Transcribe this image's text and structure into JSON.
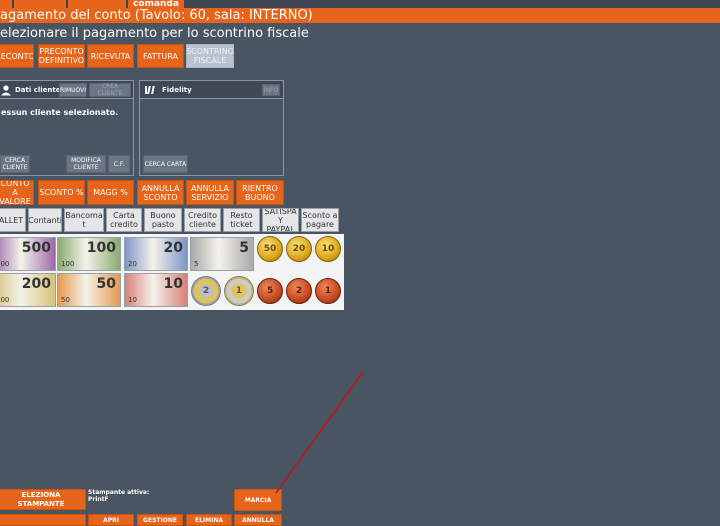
{
  "top_tab": "comanda",
  "title": "agamento del conto (Tavolo: 60, sala: INTERNO)",
  "subtitle": "elezionare il pagamento per lo scontrino fiscale",
  "doc_buttons": [
    {
      "label": "RECONTO"
    },
    {
      "label": "PRECONTO\nDEFINITIVO"
    },
    {
      "label": "RICEVUTA"
    },
    {
      "label": "FATTURA"
    },
    {
      "label": "SCONTRINO\nFISCALE",
      "selected": true
    }
  ],
  "customer_panel": {
    "title": "Dati cliente",
    "remove_label": "RIMUOVI",
    "crea_label": "CREA\nCLIENTE",
    "no_customer": "essun cliente selezionato.",
    "search_label": "CERCA\nCLIENTE",
    "edit_label": "MODIFICA\nCLIENTE",
    "cf_label": "C.F."
  },
  "fidelity_panel": {
    "title": "Fidelity",
    "search_card_label": "CERCA CARTA",
    "corner_label": "INFO"
  },
  "discount_buttons": [
    {
      "label": "CONTO A\nVALORE"
    },
    {
      "label": "SCONTO %"
    },
    {
      "label": "MAGG %"
    },
    {
      "label": "ANNULLA\nSCONTO"
    },
    {
      "label": "ANNULLA\nSERVIZIO"
    },
    {
      "label": "RIENTRO\nBUONO"
    }
  ],
  "payment_methods": [
    {
      "label": "ALLET"
    },
    {
      "label": "Contanti"
    },
    {
      "label": "Bancoma\nt"
    },
    {
      "label": "Carta\ncredito"
    },
    {
      "label": "Buono\npasto"
    },
    {
      "label": "Credito\ncliente"
    },
    {
      "label": "Resto\nticket"
    },
    {
      "label": "SATISPA\nY\nPAYPAL"
    },
    {
      "label": "Sconto a\npagare"
    }
  ],
  "banknotes_row1": [
    {
      "value": "500",
      "color": "#9b6aa8"
    },
    {
      "value": "100",
      "color": "#8bab6e"
    },
    {
      "value": "20",
      "color": "#7f95c8"
    },
    {
      "value": "5",
      "color": "#a9aaa9"
    }
  ],
  "banknotes_row2": [
    {
      "value": "200",
      "color": "#d6c27a"
    },
    {
      "value": "50",
      "color": "#e59a4f"
    },
    {
      "value": "10",
      "color": "#d8817a"
    }
  ],
  "coins_row1": [
    {
      "value": "50",
      "style": "gold"
    },
    {
      "value": "20",
      "style": "gold"
    },
    {
      "value": "10",
      "style": "gold"
    }
  ],
  "coins_row2": [
    {
      "value": "2",
      "style": "bimetal"
    },
    {
      "value": "1",
      "style": "bimetal2"
    },
    {
      "value": "5",
      "style": "copper"
    },
    {
      "value": "2",
      "style": "copper"
    },
    {
      "value": "1",
      "style": "copper"
    }
  ],
  "bottom": {
    "printer_select_label": "ELEZIONA STAMPANTE",
    "active_printer_label": "Stampante attiva:",
    "active_printer_value": "PrintF",
    "marcia_label": "MARCIA",
    "apri_label": "APRI",
    "gestione_label": "GESTIONE",
    "elimina_label": "ELIMINA",
    "annulla_label": "ANNULLA"
  },
  "colors": {
    "accent": "#e7641b",
    "background": "#4a5563",
    "annotation_line": "#c0141e"
  }
}
